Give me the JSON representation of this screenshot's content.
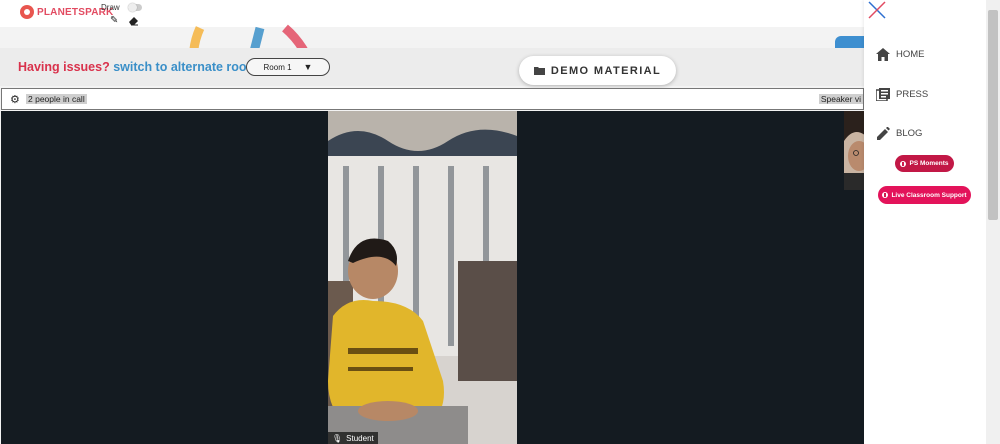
{
  "header": {
    "logo_text": "PLANETSPARK",
    "draw_label": "Draw"
  },
  "notice": {
    "issues_text": "Having issues?",
    "switch_text": "switch to alternate room"
  },
  "room_select": {
    "value": "Room 1"
  },
  "demo_material": {
    "label": "DEMO MATERIAL"
  },
  "call_bar": {
    "people_count_text": "2 people in call",
    "speaker_view_text": "Speaker vi"
  },
  "video": {
    "student_label": "Student"
  },
  "side_menu": {
    "items": [
      {
        "label": "HOME",
        "icon": "home-icon"
      },
      {
        "label": "PRESS",
        "icon": "press-icon"
      },
      {
        "label": "BLOG",
        "icon": "pencil-icon"
      }
    ],
    "ps_moments_label": "PS Moments",
    "live_support_label": "Live Classroom Support"
  },
  "colors": {
    "brand_red": "#d9324c",
    "link_blue": "#3a8fc8",
    "pill_red": "#cf1b4f",
    "video_bg": "#141b21"
  }
}
